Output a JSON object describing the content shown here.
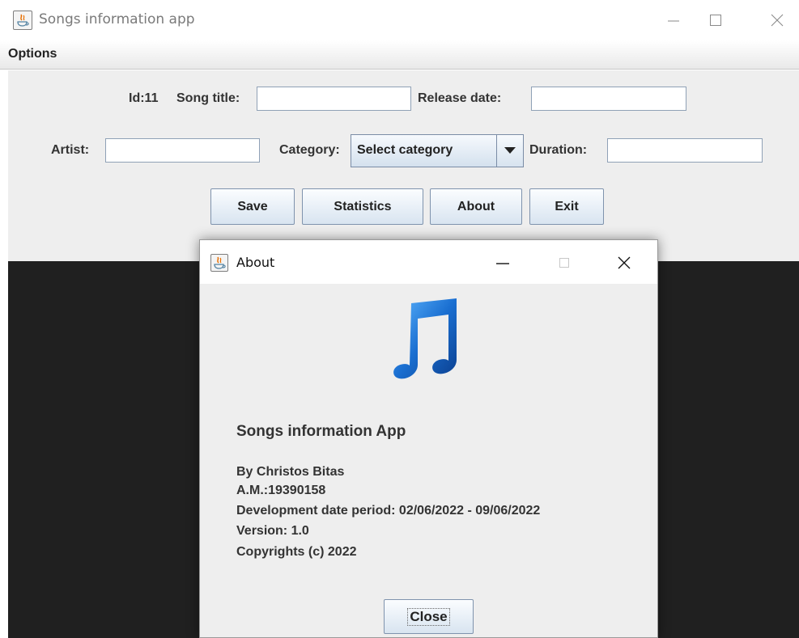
{
  "window": {
    "title": "Songs information app"
  },
  "menu": {
    "options_label": "Options"
  },
  "form": {
    "id_label": "Id:11",
    "song_title_label": "Song title:",
    "song_title_value": "",
    "release_date_label": "Release date:",
    "release_date_value": "",
    "artist_label": "Artist:",
    "artist_value": "",
    "category_label": "Category:",
    "category_selected": "Select  category",
    "duration_label": "Duration:",
    "duration_value": ""
  },
  "buttons": {
    "save": "Save",
    "statistics": "Statistics",
    "about": "About",
    "exit": "Exit"
  },
  "about_dialog": {
    "title": "About",
    "app_name": "Songs information App",
    "lines": [
      "By Christos Bitas",
      "A.M.:19390158",
      "Development date period: 02/06/2022 - 09/06/2022",
      "Version: 1.0",
      "Copyrights (c) 2022"
    ],
    "close_label": "Close",
    "icon": "music-note-icon"
  },
  "colors": {
    "accent_blue": "#1a6fd1",
    "button_gradient_top": "#fbfdff",
    "button_gradient_bottom": "#d8e4f0",
    "dark_background": "#202020"
  }
}
